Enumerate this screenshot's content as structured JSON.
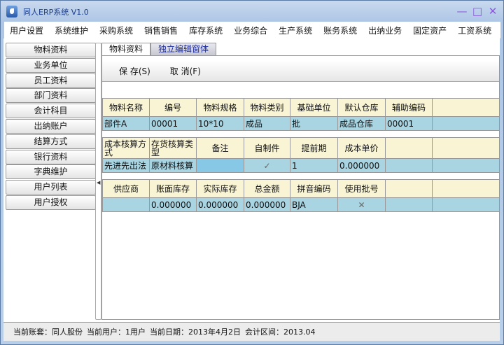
{
  "window": {
    "title": "同人ERP系统 V1.0",
    "minimize": "—",
    "maximize": "□",
    "close": "✕"
  },
  "menu": [
    "用户设置",
    "系统维护",
    "采购系统",
    "销售销售",
    "库存系统",
    "业务综合",
    "生产系统",
    "账务系统",
    "出纳业务",
    "固定资产",
    "工资系统"
  ],
  "sidebar": [
    "物料资料",
    "业务单位",
    "员工资料",
    "部门资料",
    "会计科目",
    "出纳账户",
    "结算方式",
    "银行资料",
    "字典维护",
    "用户列表",
    "用户授权"
  ],
  "tabs": [
    {
      "label": "物料资料",
      "active": false
    },
    {
      "label": "独立编辑窗体",
      "active": true
    }
  ],
  "toolbar": {
    "save": "保 存(S)",
    "cancel": "取 消(F)"
  },
  "table1": {
    "headers": [
      "物料名称",
      "编号",
      "物料规格",
      "物料类别",
      "基础单位",
      "默认仓库",
      "辅助编码",
      ""
    ],
    "row": [
      "部件A",
      "00001",
      "10*10",
      "成品",
      "批",
      "成品仓库",
      "00001",
      ""
    ]
  },
  "table2": {
    "headers": [
      "成本核算方式",
      "存货核算类型",
      "备注",
      "自制件",
      "提前期",
      "成本单价",
      "",
      ""
    ],
    "row": [
      "先进先出法",
      "原材料核算",
      "",
      "✓",
      "1",
      "0.000000",
      "",
      ""
    ]
  },
  "table3": {
    "headers": [
      "供应商",
      "账面库存",
      "实际库存",
      "总金额",
      "拼音编码",
      "使用批号",
      "",
      ""
    ],
    "row": [
      "",
      "0.000000",
      "0.000000",
      "0.000000",
      "BJA",
      "✕",
      "",
      ""
    ]
  },
  "status": {
    "account": "当前账套：同人股份",
    "user": "当前用户：1用户",
    "date": "当前日期：2013年4月2日",
    "period": "会计区间：2013.04"
  }
}
